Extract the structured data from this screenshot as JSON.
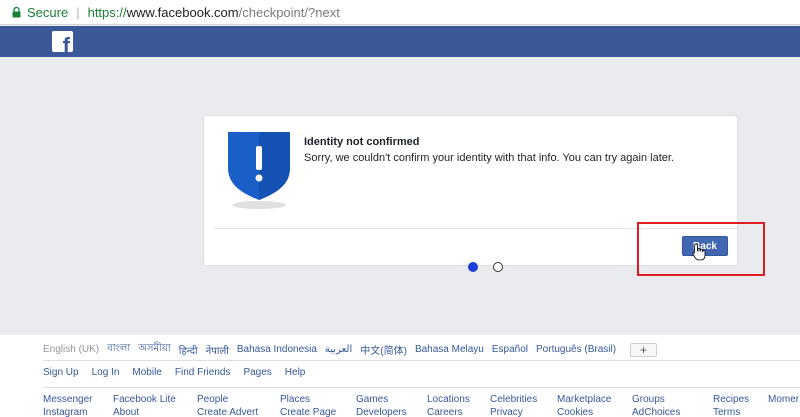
{
  "browser": {
    "secure_label": "Secure",
    "url_scheme": "https://",
    "url_host": "www.facebook.com",
    "url_path": "/checkpoint/?next"
  },
  "header": {
    "logo": "f"
  },
  "card": {
    "title": "Identity not confirmed",
    "message": "Sorry, we couldn't confirm your identity with that info. You can try again later.",
    "back_label": "Back",
    "icon": "shield-exclamation-icon"
  },
  "colors": {
    "brand": "#3b5998",
    "button": "#4267b2",
    "highlight": "#e21b23",
    "shield": "#1a5fc8"
  },
  "footer": {
    "languages": [
      "English (UK)",
      "বাংলা",
      "অসমীয়া",
      "हिन्दी",
      "नेपाली",
      "Bahasa Indonesia",
      "العربية",
      "中文(简体)",
      "Bahasa Melayu",
      "Español",
      "Português (Brasil)"
    ],
    "more_languages": "+",
    "links_row1": [
      "Sign Up",
      "Log In",
      "Messenger",
      "Facebook Lite",
      "Mobile",
      "Find Friends",
      "People",
      "Pages",
      "Places",
      "Games",
      "Locations",
      "Celebrities",
      "Marketplace",
      "Groups",
      "Recipes",
      "Moments"
    ],
    "nav_links": [
      "Sign Up",
      "Log In",
      "Mobile",
      "Find Friends",
      "Pages",
      "Help"
    ],
    "grid_row1": [
      "Messenger",
      "Facebook Lite",
      "People",
      "Places",
      "Games",
      "Locations",
      "Celebrities",
      "Marketplace",
      "Groups",
      "Recipes",
      "Momer"
    ],
    "grid_row2": [
      "Instagram",
      "About",
      "Create Advert",
      "Create Page",
      "Developers",
      "Careers",
      "Privacy",
      "Cookies",
      "AdChoices",
      "Terms"
    ]
  }
}
